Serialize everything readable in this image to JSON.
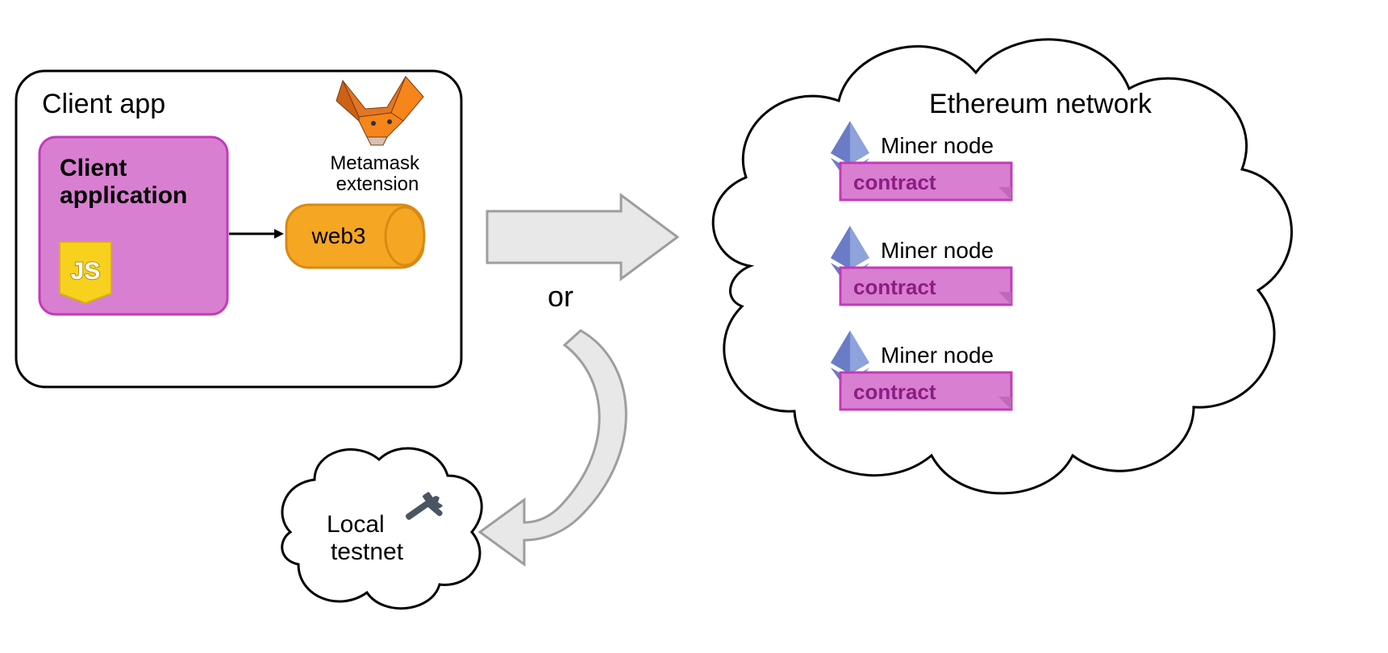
{
  "clientBox": {
    "title": "Client app",
    "clientApplication": "Client\napplication",
    "web3": "web3",
    "metamask": "Metamask\nextension"
  },
  "connector": {
    "or": "or"
  },
  "localTestnet": {
    "label": "Local\ntestnet"
  },
  "ethereum": {
    "title": "Ethereum network",
    "nodes": [
      {
        "label": "Miner node",
        "contract": "contract"
      },
      {
        "label": "Miner node",
        "contract": "contract"
      },
      {
        "label": "Miner node",
        "contract": "contract"
      }
    ]
  },
  "icons": {
    "js": "JS",
    "metamaskFox": "metamask-fox-icon",
    "ethDiamond": "ethereum-diamond-icon",
    "tools": "hammer-wrench-icon"
  },
  "colors": {
    "magenta": "#d97fd1",
    "magentaStroke": "#c23bb8",
    "orange": "#f5a623",
    "orangeDark": "#d88a12",
    "jsYellow": "#f7d11e",
    "ethBlue": "#6a7cc5",
    "ethBlueLight": "#8ea2db",
    "arrowFill": "#e8e8e8",
    "arrowStroke": "#9e9e9e",
    "black": "#000000",
    "toolGray": "#4b5562"
  }
}
